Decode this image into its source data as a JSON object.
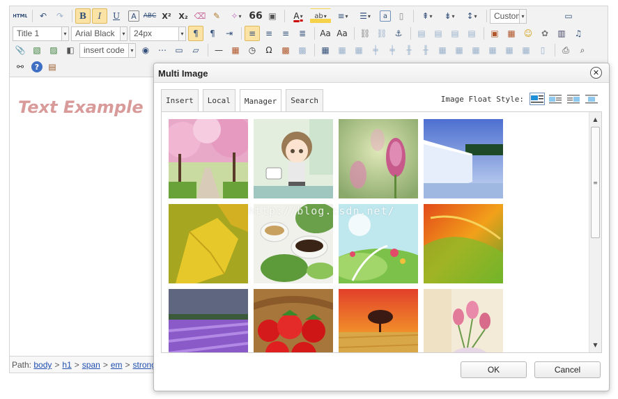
{
  "toolbar": {
    "font_style": "Title 1",
    "font_family": "Arial Black",
    "font_size": "24px",
    "custom_style": "CustomStyl",
    "insert_code": "insert code",
    "html_label": "HTML",
    "quote_glyph": "66",
    "superscript": "X²",
    "subscript": "X₂"
  },
  "editor": {
    "heading_text": "Text Example",
    "heading_color": "#d99a9a"
  },
  "statusbar": {
    "path_label": "Path:",
    "crumbs": [
      "body",
      "h1",
      "span",
      "em",
      "strong"
    ]
  },
  "dialog": {
    "title": "Multi Image",
    "tabs": [
      "Insert",
      "Local",
      "Manager",
      "Search"
    ],
    "selected_tab": "Manager",
    "float_label": "Image Float Style:",
    "watermark": "http://blog.csdn.net/",
    "ok_label": "OK",
    "cancel_label": "Cancel",
    "images": [
      "cherry-blossom-avenue",
      "anime-character",
      "pink-flowers",
      "waterfall",
      "yellow-leaf",
      "tea-cups",
      "cartoon-meadow",
      "autumn-leaf",
      "lavender-field",
      "strawberries",
      "sunset-tree",
      "pink-tulips"
    ]
  },
  "colors": {
    "accent": "#33507a",
    "active_button": "#fbe3a6",
    "link": "#1f4fb0"
  }
}
